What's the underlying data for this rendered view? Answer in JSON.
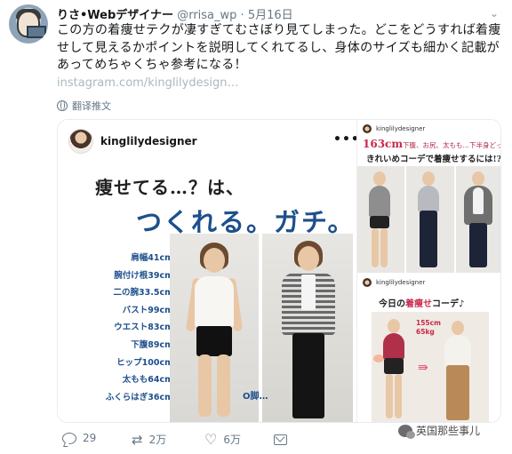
{
  "tweet": {
    "display_name": "りさ•Webデザイナー",
    "username": "@rrisa_wp",
    "separator": "·",
    "date": "5月16日",
    "text": "この方の着痩せテクが凄すぎてむさぼり見てしまった。どこをどうすれば着痩せして見えるかポイントを説明してくれてるし、身体のサイズも細かく記載があってめちゃくちゃ参考になる！",
    "link": "instagram.com/kinglilydesign…",
    "translate_label": "翻译推文"
  },
  "media": {
    "left_post": {
      "username": "kinglilydesigner",
      "headline_1": "痩せてる…？は、",
      "headline_2": "つくれる。ガチ。",
      "measurements": [
        "肩幅41cm",
        "腕付け根39cm",
        "二の腕33.5cm",
        "バスト99cm",
        "ウエスト83cm",
        "下腹89cm",
        "ヒップ100cm",
        "太もも64cm",
        "ふくらはぎ36cm"
      ],
      "legs_label": "O脚…"
    },
    "right_collage": {
      "username_top": "kinglilydesigner",
      "height_big": "163cm",
      "height_rest": "下腹、お尻、太もも…下半身どっしりママ",
      "headline": "きれいめコーデで着痩せするには!?",
      "username_mid": "kinglilydesigner",
      "sub_pre": "今日の",
      "sub_red": "着痩せ",
      "sub_post": "コーデ♪",
      "tag_height": "155cm",
      "tag_weight": "65kg",
      "arrow": "⇛"
    }
  },
  "actions": {
    "reply_count": "29",
    "retweet_count": "2万",
    "like_count": "6万"
  },
  "watermark": "英国那些事儿",
  "icons": {
    "chevron": "chevron-down-icon",
    "reply": "reply-icon",
    "retweet": "retweet-icon",
    "like": "heart-icon",
    "dm": "direct-message-icon"
  },
  "colors": {
    "link": "#aab8c2",
    "muted": "#657786",
    "headline_blue": "#1d4f8c",
    "accent_red": "#c8284c"
  }
}
